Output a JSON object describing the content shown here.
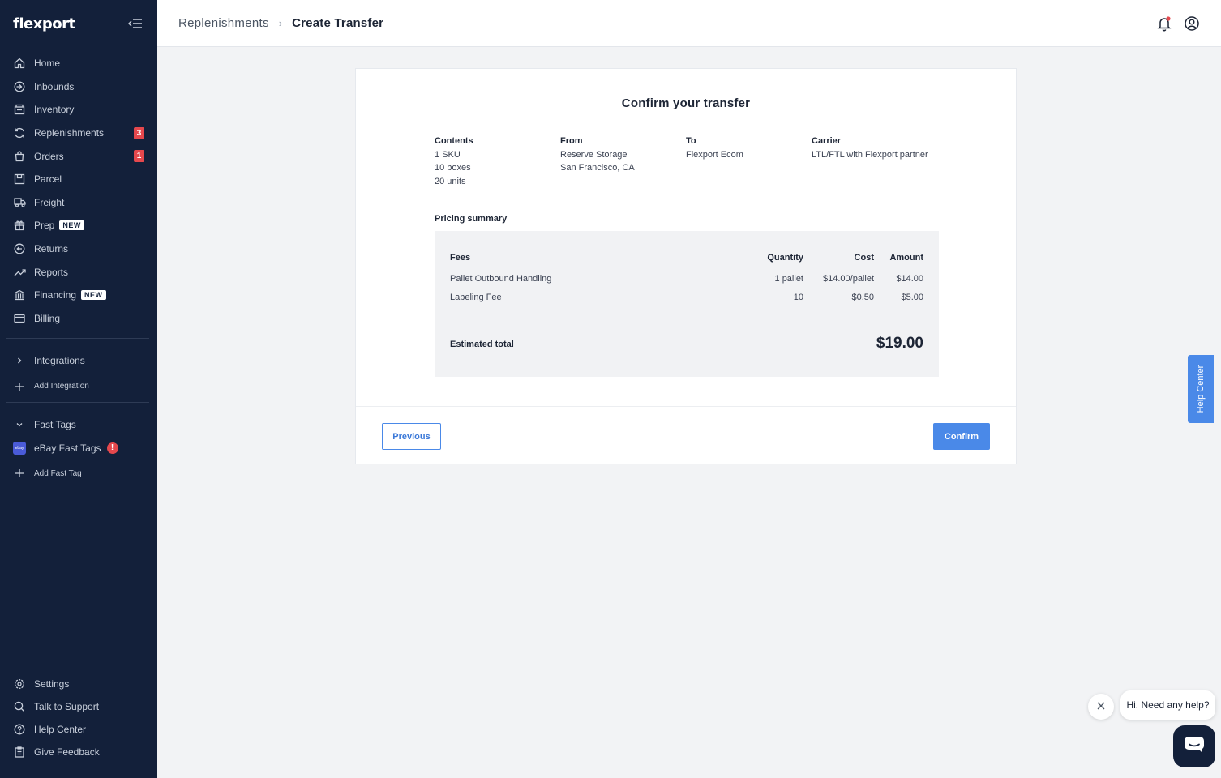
{
  "app": {
    "logo": "flexport"
  },
  "sidebar": {
    "items": [
      {
        "label": "Home",
        "icon": "home-icon"
      },
      {
        "label": "Inbounds",
        "icon": "inbound-icon"
      },
      {
        "label": "Inventory",
        "icon": "inventory-icon"
      },
      {
        "label": "Replenishments",
        "icon": "replenish-icon",
        "badge": "3"
      },
      {
        "label": "Orders",
        "icon": "orders-icon",
        "badge": "1"
      },
      {
        "label": "Parcel",
        "icon": "parcel-icon"
      },
      {
        "label": "Freight",
        "icon": "truck-icon"
      },
      {
        "label": "Prep",
        "icon": "gift-icon",
        "tag": "NEW"
      },
      {
        "label": "Returns",
        "icon": "returns-icon"
      },
      {
        "label": "Reports",
        "icon": "reports-icon"
      },
      {
        "label": "Financing",
        "icon": "bank-icon",
        "tag": "NEW"
      },
      {
        "label": "Billing",
        "icon": "billing-icon"
      }
    ],
    "integrations": {
      "label": "Integrations",
      "add_label": "Add Integration"
    },
    "fast_tags": {
      "label": "Fast Tags",
      "ebay_label": "eBay Fast Tags",
      "ebay_logo": "ebay",
      "alert": "!",
      "add_label": "Add Fast Tag"
    },
    "bottom": [
      {
        "label": "Settings",
        "icon": "gear-icon"
      },
      {
        "label": "Talk to Support",
        "icon": "support-icon"
      },
      {
        "label": "Help Center",
        "icon": "help-icon"
      },
      {
        "label": "Give Feedback",
        "icon": "feedback-icon"
      }
    ]
  },
  "header": {
    "breadcrumb_parent": "Replenishments",
    "breadcrumb_sep": "›",
    "breadcrumb_current": "Create Transfer"
  },
  "card": {
    "title": "Confirm your transfer",
    "contents": {
      "label": "Contents",
      "lines": [
        "1 SKU",
        "10 boxes",
        "20 units"
      ]
    },
    "from": {
      "label": "From",
      "lines": [
        "Reserve Storage",
        "San Francisco, CA"
      ]
    },
    "to": {
      "label": "To",
      "lines": [
        "Flexport Ecom"
      ]
    },
    "carrier": {
      "label": "Carrier",
      "lines": [
        "LTL/FTL with Flexport partner"
      ]
    },
    "pricing_label": "Pricing summary",
    "pricing": {
      "headers": {
        "fees": "Fees",
        "quantity": "Quantity",
        "cost": "Cost",
        "amount": "Amount"
      },
      "rows": [
        {
          "fee": "Pallet Outbound Handling",
          "quantity": "1 pallet",
          "cost": "$14.00/pallet",
          "amount": "$14.00"
        },
        {
          "fee": "Labeling Fee",
          "quantity": "10",
          "cost": "$0.50",
          "amount": "$5.00"
        }
      ],
      "estimated_label": "Estimated total",
      "estimated_value": "$19.00"
    },
    "previous_label": "Previous",
    "confirm_label": "Confirm"
  },
  "help_tab": "Help Center",
  "chat": {
    "bubble": "Hi. Need any help?"
  },
  "colors": {
    "sidebar_bg": "#13203a",
    "accent": "#4a89e8",
    "badge": "#e5484d"
  }
}
